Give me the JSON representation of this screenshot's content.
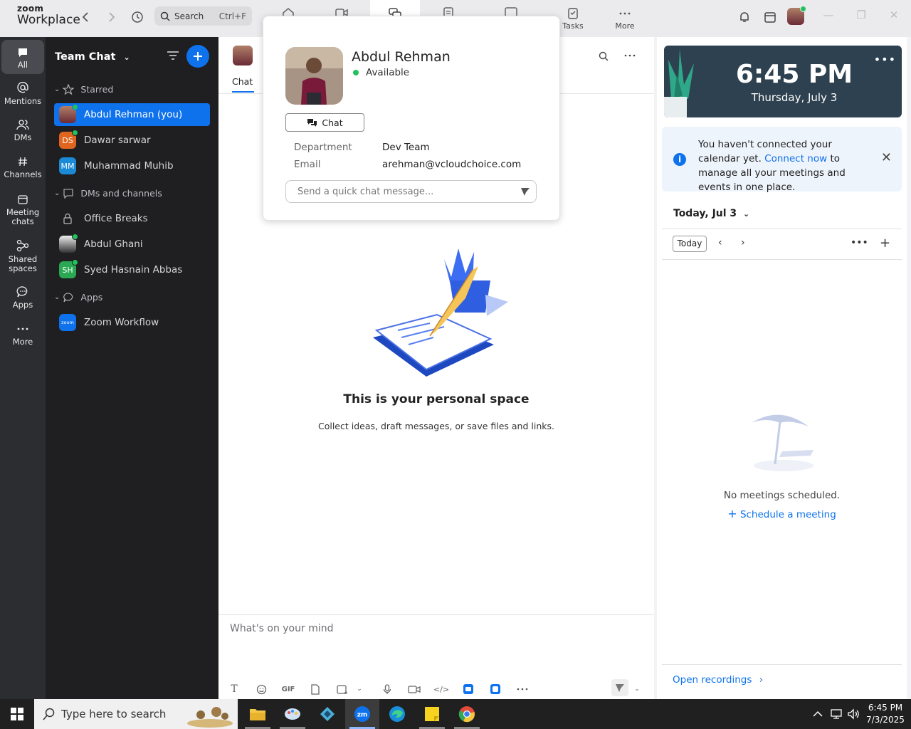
{
  "app": {
    "logo_top": "zoom",
    "logo_bottom": "Workplace"
  },
  "titlebar": {
    "search_placeholder": "Search",
    "search_shortcut": "Ctrl+F",
    "nav_tabs": [
      {
        "icon": "home-icon",
        "label": ""
      },
      {
        "icon": "video-camera-icon",
        "label": ""
      },
      {
        "icon": "team-chat-icon",
        "label": ""
      },
      {
        "icon": "docs-icon",
        "label": ""
      },
      {
        "icon": "whiteboard-icon",
        "label": ""
      },
      {
        "icon": "tasks-icon",
        "label": "Tasks"
      },
      {
        "icon": "more-dots-icon",
        "label": "More"
      }
    ]
  },
  "rail": {
    "items": [
      {
        "icon": "chat-bubble-icon",
        "label": "All"
      },
      {
        "icon": "at-sign-icon",
        "label": "Mentions"
      },
      {
        "icon": "people-icon",
        "label": "DMs"
      },
      {
        "icon": "hash-icon",
        "label": "Channels"
      },
      {
        "icon": "calendar-icon",
        "label": "Meeting chats"
      },
      {
        "icon": "shared-space-icon",
        "label": "Shared spaces"
      },
      {
        "icon": "apps-bubble-icon",
        "label": "Apps"
      },
      {
        "icon": "more-dots-icon",
        "label": "More"
      }
    ]
  },
  "chatlist": {
    "title": "Team Chat",
    "sections": {
      "starred": "Starred",
      "dms": "DMs and channels",
      "apps": "Apps"
    },
    "starred_items": [
      {
        "name": "Abdul Rehman (you)",
        "avatar": "photo",
        "online": true,
        "selected": true
      },
      {
        "name": "Dawar sarwar",
        "avatar": "DS",
        "color": "#e0651f",
        "online": true
      },
      {
        "name": "Muhammad Muhib",
        "avatar": "MM",
        "color": "#1b8ad6",
        "online": false
      }
    ],
    "dm_items": [
      {
        "name": "Office Breaks",
        "avatar": "lock-icon"
      },
      {
        "name": "Abdul Ghani",
        "avatar": "photo2",
        "online": true
      },
      {
        "name": "Syed Hasnain Abbas",
        "avatar": "SH",
        "color": "#2aa854",
        "online": true
      }
    ],
    "app_items": [
      {
        "name": "Zoom Workflow",
        "avatar": "zoom",
        "color": "#0e72ed"
      }
    ]
  },
  "main": {
    "tab": "Chat",
    "empty_title": "This is your personal space",
    "empty_subtitle": "Collect ideas, draft messages, or save files and links.",
    "composer_placeholder": "What's on your mind",
    "gif_label": "GIF"
  },
  "popup": {
    "name": "Abdul Rehman",
    "status": "Available",
    "chat_button": "Chat",
    "department_label": "Department",
    "department_value": "Dev Team",
    "email_label": "Email",
    "email_value": "arehman@vcloudchoice.com",
    "quick_message_placeholder": "Send a quick chat message..."
  },
  "right": {
    "time": "6:45 PM",
    "date": "Thursday, July 3",
    "notice_text_1": "You haven't connected your calendar yet.",
    "notice_link": "Connect now",
    "notice_text_2": "to manage all your meetings and events in one place.",
    "day_selector": "Today, Jul 3",
    "today_button": "Today",
    "no_meetings": "No meetings scheduled.",
    "schedule_link": "Schedule a meeting",
    "open_recordings": "Open recordings"
  },
  "taskbar": {
    "search_placeholder": "Type here to search",
    "time": "6:45 PM",
    "date": "7/3/2025"
  },
  "colors": {
    "accent": "#0e72ed",
    "online": "#21c25d",
    "rail_bg": "#2c2d30",
    "list_bg": "#1f1f21"
  }
}
